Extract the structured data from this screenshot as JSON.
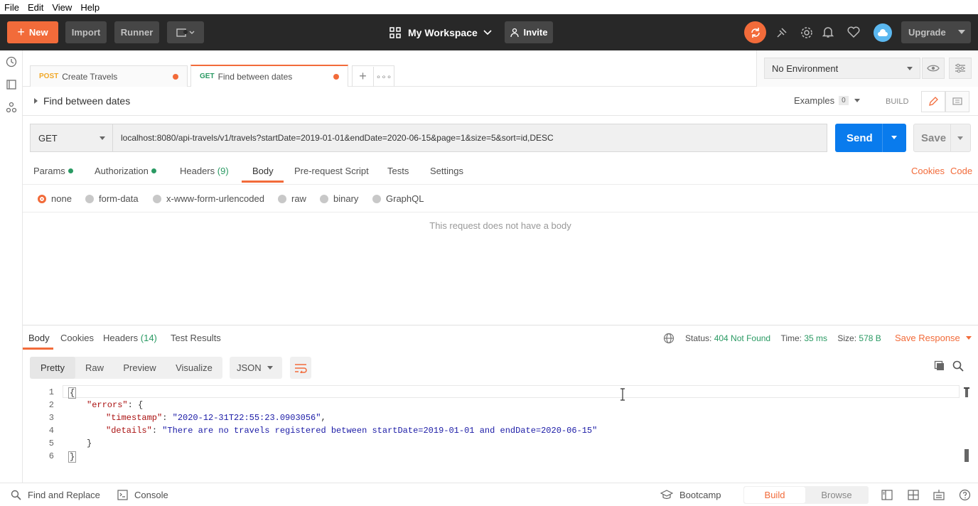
{
  "menubar": {
    "items": [
      "File",
      "Edit",
      "View",
      "Help"
    ]
  },
  "header": {
    "new_label": "New",
    "import_label": "Import",
    "runner_label": "Runner",
    "workspace_label": "My Workspace",
    "invite_label": "Invite",
    "upgrade_label": "Upgrade"
  },
  "tabs": [
    {
      "method": "POST",
      "label": "Create Travels"
    },
    {
      "method": "GET",
      "label": "Find between dates"
    }
  ],
  "environment": {
    "selected": "No Environment"
  },
  "request": {
    "title": "Find between dates",
    "examples_label": "Examples",
    "examples_count": "0",
    "build_label": "BUILD",
    "method": "GET",
    "url": "localhost:8080/api-travels/v1/travels?startDate=2019-01-01&endDate=2020-06-15&page=1&size=5&sort=id,DESC",
    "send_label": "Send",
    "save_label": "Save"
  },
  "request_tabs": {
    "params": "Params",
    "authorization": "Authorization",
    "headers": "Headers",
    "headers_count": "(9)",
    "body": "Body",
    "prerequest": "Pre-request Script",
    "tests": "Tests",
    "settings": "Settings",
    "cookies": "Cookies",
    "code": "Code"
  },
  "body_types": [
    "none",
    "form-data",
    "x-www-form-urlencoded",
    "raw",
    "binary",
    "GraphQL"
  ],
  "no_body_text": "This request does not have a body",
  "response": {
    "tabs": {
      "body": "Body",
      "cookies": "Cookies",
      "headers": "Headers",
      "headers_count": "(14)",
      "tests": "Test Results"
    },
    "status_label": "Status:",
    "status_value": "404 Not Found",
    "time_label": "Time:",
    "time_value": "35 ms",
    "size_label": "Size:",
    "size_value": "578 B",
    "save_response": "Save Response",
    "views": [
      "Pretty",
      "Raw",
      "Preview",
      "Visualize"
    ],
    "format": "JSON",
    "lines": [
      "1",
      "2",
      "3",
      "4",
      "5",
      "6"
    ],
    "code": {
      "l1": "{",
      "l2_key": "\"errors\"",
      "l2_rest": ": {",
      "l3_key": "\"timestamp\"",
      "l3_sep": ": ",
      "l3_val": "\"2020-12-31T22:55:23.0903056\"",
      "l3_end": ",",
      "l4_key": "\"details\"",
      "l4_sep": ": ",
      "l4_val": "\"There are no travels registered between startDate=2019-01-01 and endDate=2020-06-15\"",
      "l5": "}",
      "l6": "}"
    }
  },
  "footer": {
    "find_replace": "Find and Replace",
    "console": "Console",
    "bootcamp": "Bootcamp",
    "build": "Build",
    "browse": "Browse"
  },
  "colors": {
    "accent": "#f26b3a",
    "send": "#097bed",
    "dark": "#282828",
    "status_green": "#2a9a63"
  }
}
